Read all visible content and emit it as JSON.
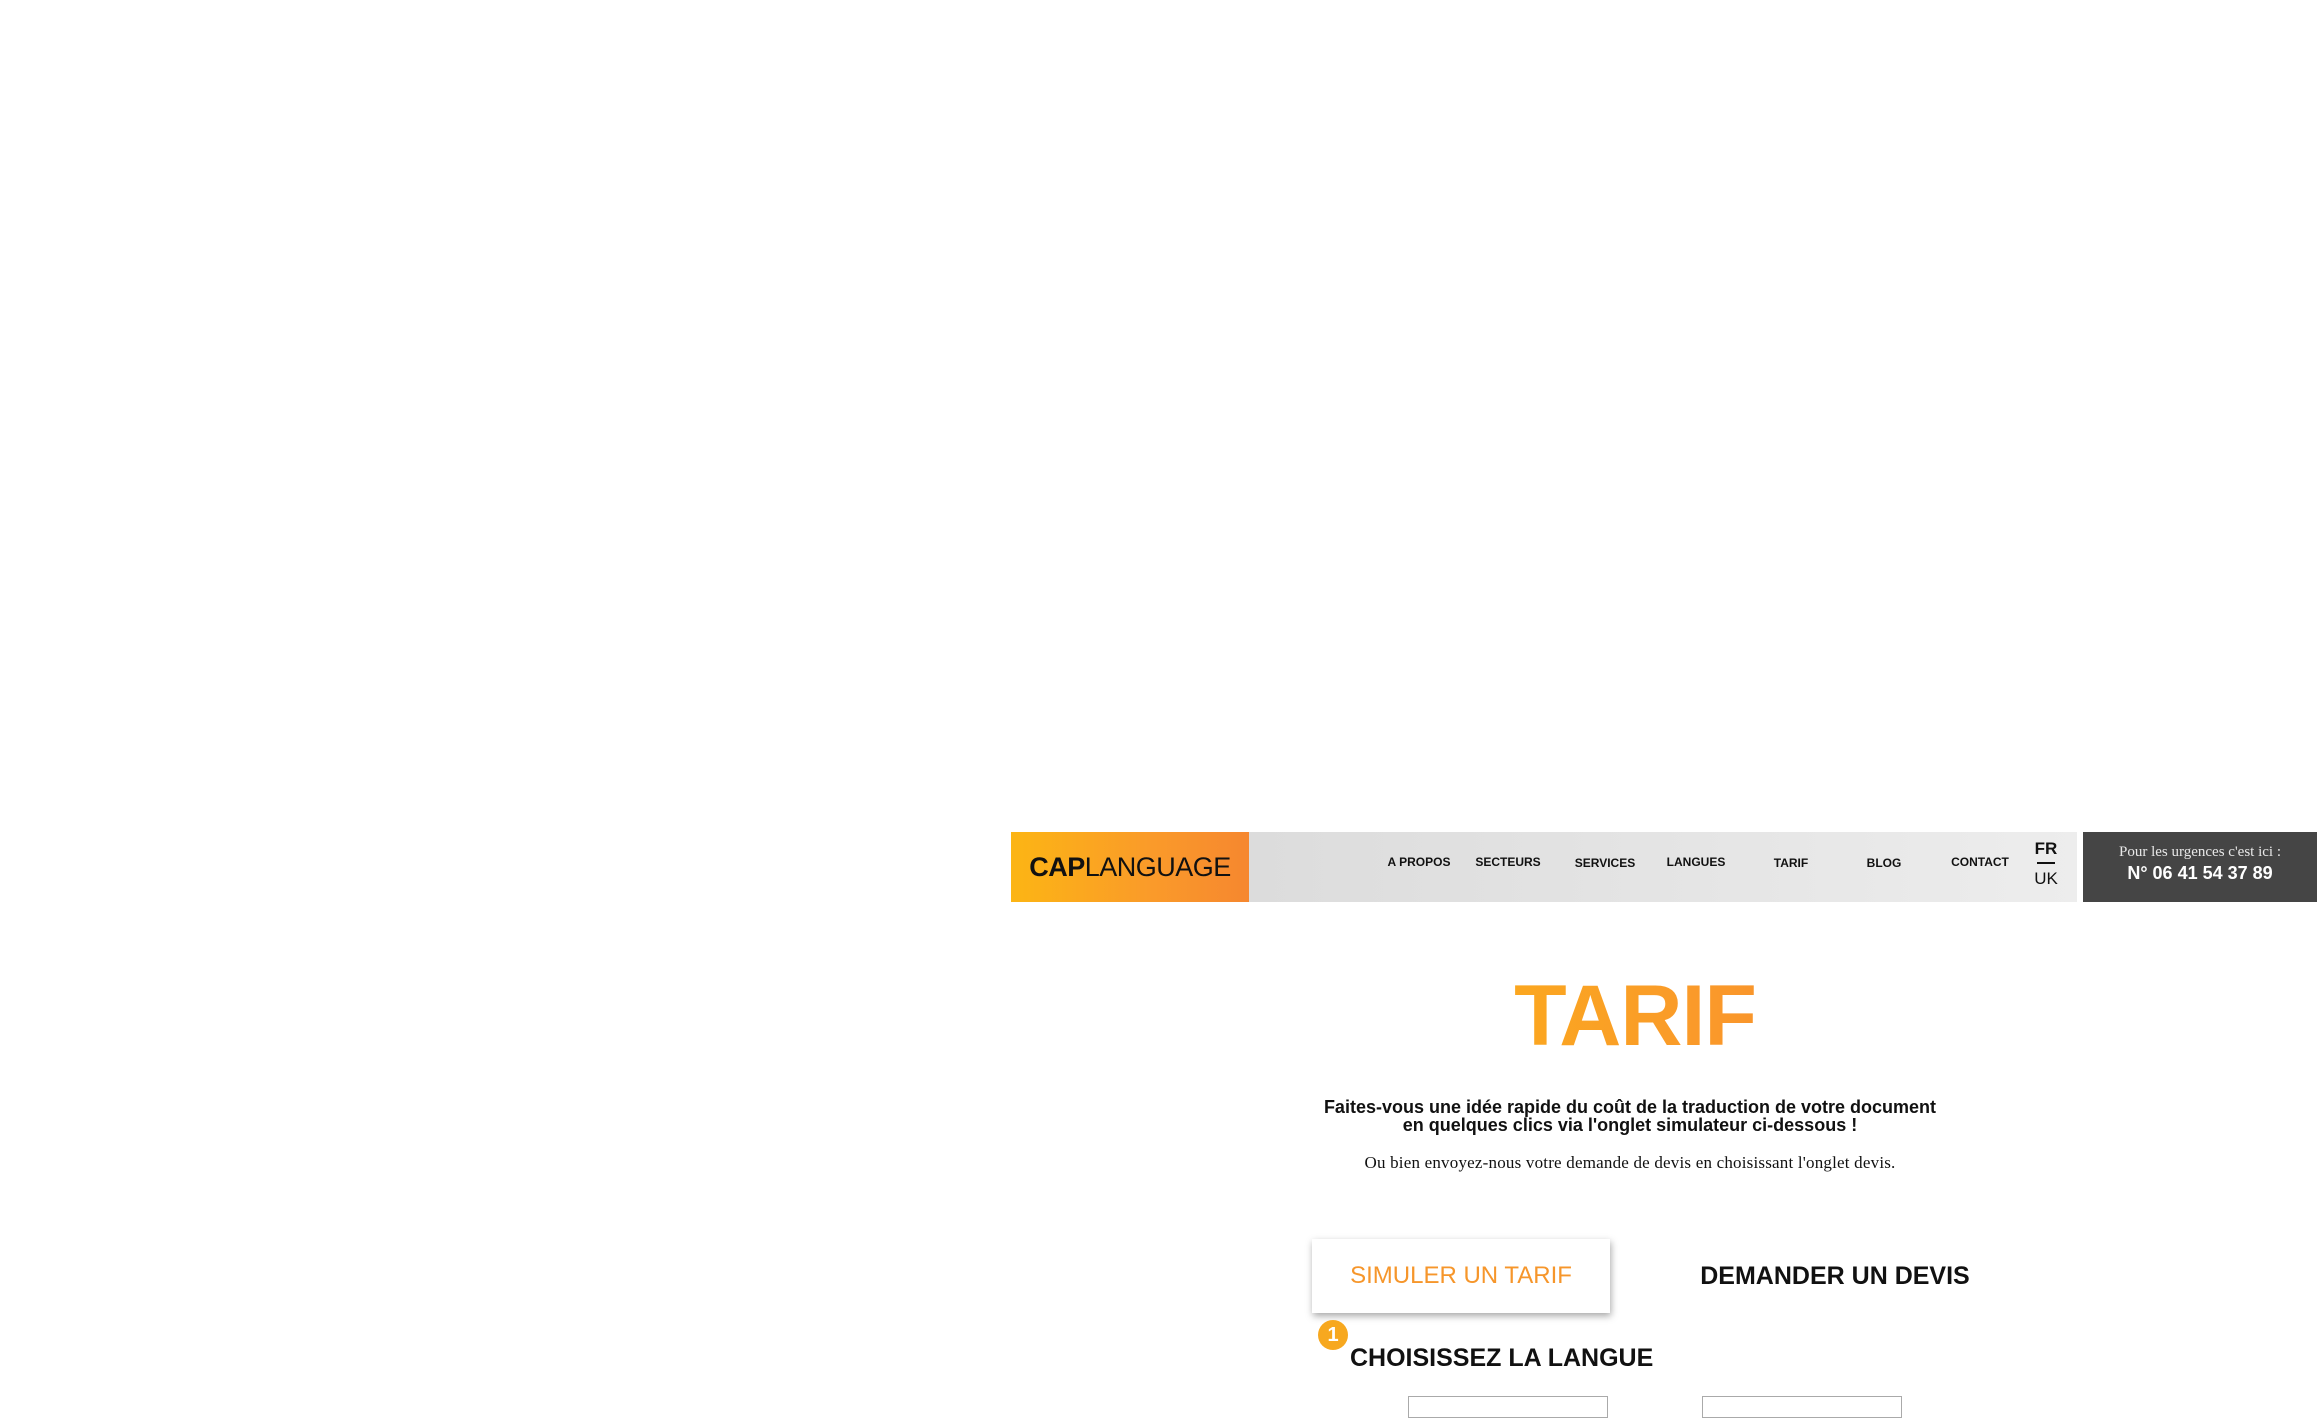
{
  "header": {
    "logo": {
      "cap": "CAP",
      "language": "LANGUAGE"
    },
    "nav": [
      {
        "label": "A PROPOS"
      },
      {
        "label": "SECTEURS"
      },
      {
        "label": "SERVICES"
      },
      {
        "label": "LANGUES"
      },
      {
        "label": "TARIF"
      },
      {
        "label": "BLOG"
      },
      {
        "label": "CONTACT"
      }
    ],
    "languages": {
      "active": "FR",
      "other": "UK"
    },
    "urgent": {
      "text": "Pour les urgences c'est ici :",
      "phone": "N° 06 41 54 37 89"
    }
  },
  "main": {
    "title": "TARIF",
    "intro_line1": "Faites-vous une idée rapide du coût de la traduction de votre document",
    "intro_line2": "en quelques clics via l'onglet simulateur ci-dessous !",
    "alt_text": "Ou bien envoyez-nous votre demande de devis en choisissant l'onglet devis.",
    "tabs": [
      {
        "label": "SIMULER UN TARIF",
        "active": true
      },
      {
        "label": "DEMANDER UN DEVIS",
        "active": false
      }
    ],
    "step": {
      "number": "1",
      "title": "CHOISISSEZ LA LANGUE"
    }
  },
  "colors": {
    "accent_orange": "#f6962b",
    "gradient_start": "#fcb514",
    "gradient_end": "#f6872f",
    "urgent_bg": "#454545"
  }
}
